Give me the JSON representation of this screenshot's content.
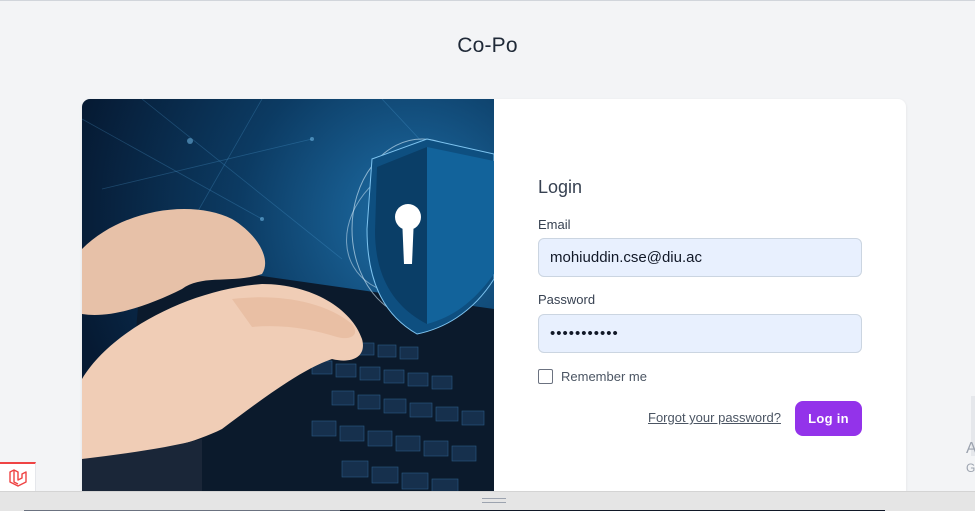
{
  "app": {
    "title": "Co-Po"
  },
  "login": {
    "heading": "Login",
    "email_label": "Email",
    "email_value": "mohiuddin.cse@diu.ac",
    "password_label": "Password",
    "password_value": "•••••••••••",
    "remember_label": "Remember me",
    "remember_checked": false,
    "forgot_link": "Forgot your password?",
    "submit_label": "Log in"
  },
  "colors": {
    "accent": "#9333ea",
    "input_bg": "#e8f0fe",
    "page_bg": "#f3f4f6",
    "hero_dark": "#061a33",
    "hero_mid": "#1e6fa8"
  },
  "icons": {
    "hero": "security-shield-keyboard-image",
    "badge": "laravel-logo-icon"
  },
  "edge": {
    "char1": "A",
    "char2": "G"
  }
}
